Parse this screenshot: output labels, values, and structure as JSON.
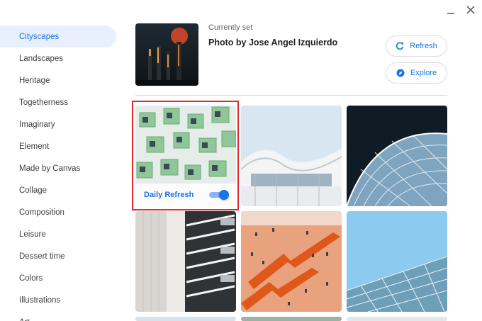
{
  "sidebar": {
    "items": [
      {
        "label": "Cityscapes",
        "active": true
      },
      {
        "label": "Landscapes"
      },
      {
        "label": "Heritage"
      },
      {
        "label": "Togetherness"
      },
      {
        "label": "Imaginary"
      },
      {
        "label": "Element"
      },
      {
        "label": "Made by Canvas"
      },
      {
        "label": "Collage"
      },
      {
        "label": "Composition"
      },
      {
        "label": "Leisure"
      },
      {
        "label": "Dessert time"
      },
      {
        "label": "Colors"
      },
      {
        "label": "Illustrations"
      },
      {
        "label": "Art"
      }
    ]
  },
  "current": {
    "label": "Currently set",
    "title": "Photo by Jose Angel Izquierdo"
  },
  "actions": {
    "refresh_label": "Refresh",
    "refresh_icon": "refresh-icon",
    "explore_label": "Explore",
    "explore_icon": "explore-compass-icon"
  },
  "daily_refresh": {
    "label": "Daily Refresh",
    "enabled": true
  },
  "colors": {
    "accent": "#1a73e8",
    "active_bg": "#e8f0fe",
    "selection_frame": "#e8262d"
  }
}
